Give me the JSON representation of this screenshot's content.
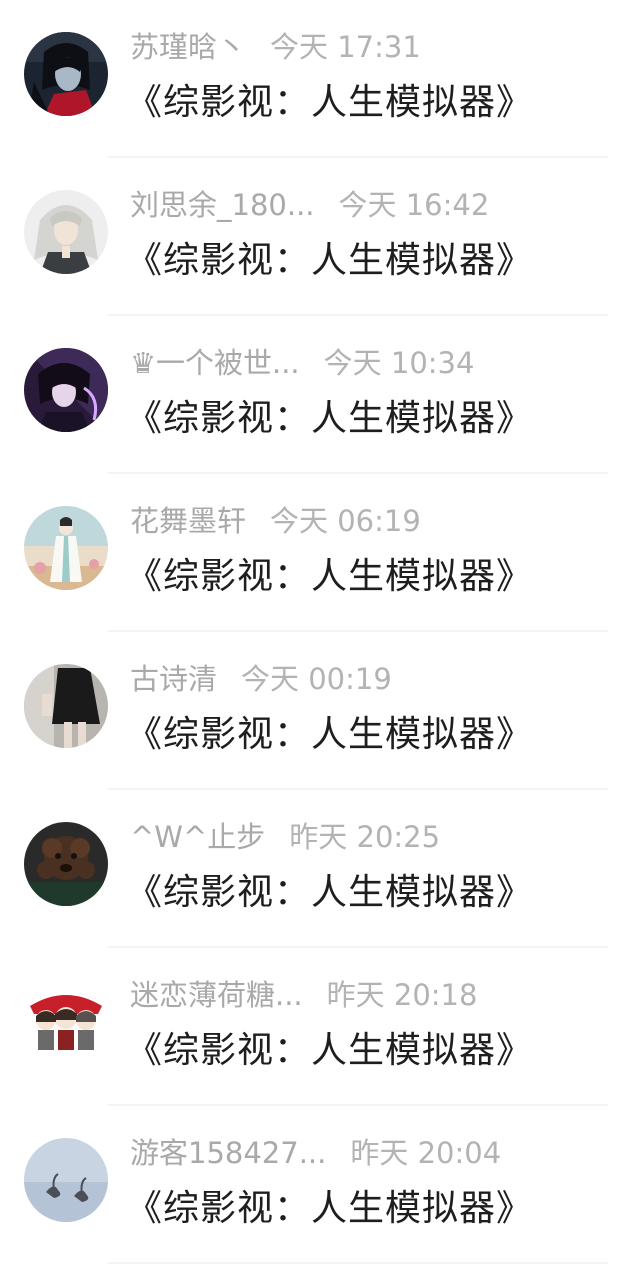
{
  "messages": [
    {
      "name": "苏瑾晗丶",
      "time": "今天 17:31",
      "title": "《综影视：人生模拟器》",
      "avatar": "dark-hair-red-robe-avatar"
    },
    {
      "name": "刘思余_180...",
      "time": "今天 16:42",
      "title": "《综影视：人生模拟器》",
      "avatar": "silver-hair-avatar"
    },
    {
      "name": "♛一个被世...",
      "time": "今天 10:34",
      "title": "《综影视：人生模拟器》",
      "avatar": "purple-glow-avatar"
    },
    {
      "name": "花舞墨轩",
      "time": "今天 06:19",
      "title": "《综影视：人生模拟器》",
      "avatar": "white-robe-figure-avatar"
    },
    {
      "name": "古诗清",
      "time": "今天 00:19",
      "title": "《综影视：人生模拟器》",
      "avatar": "black-skirt-photo-avatar"
    },
    {
      "name": "^W^止步",
      "time": "昨天 20:25",
      "title": "《综影视：人生模拟器》",
      "avatar": "brown-poodle-avatar"
    },
    {
      "name": "迷恋薄荷糖...",
      "time": "昨天 20:18",
      "title": "《综影视：人生模拟器》",
      "avatar": "chibi-girls-avatar"
    },
    {
      "name": "游客158427...",
      "time": "昨天 20:04",
      "title": "《综影视：人生模拟器》",
      "avatar": "swan-lake-avatar"
    }
  ]
}
